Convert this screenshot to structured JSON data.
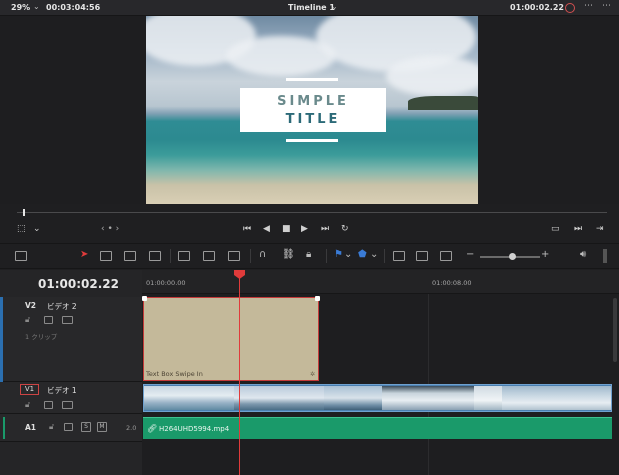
{
  "topbar": {
    "zoom": "29%",
    "duration": "00:03:04:56",
    "timeline_title": "Timeline 1",
    "timecode": "01:00:02.22",
    "chevron": "⌄"
  },
  "viewer": {
    "title_line1": "SIMPLE",
    "title_line2": "TITLE"
  },
  "transport": {
    "nav_dots": "‹ • ›"
  },
  "timeline": {
    "timecode": "01:00:02.22",
    "ruler": [
      "01:00:00.00",
      "01:00:08.00"
    ],
    "tracks": {
      "v2": {
        "id": "V2",
        "name": "ビデオ 2",
        "clip_count": "1 クリップ"
      },
      "v1": {
        "id": "V1",
        "name": "ビデオ 1"
      },
      "a1": {
        "id": "A1",
        "volume": "2.0",
        "s_label": "S",
        "m_label": "M"
      }
    },
    "clips": {
      "title_clip": "Text Box Swipe In",
      "audio_clip": "H264UHD5994.mp4"
    }
  },
  "colors": {
    "accent_red": "#e03b3b",
    "audio_green": "#1a9a6a",
    "video_blue": "#4a7fb0",
    "title_clip": "#c4b99a"
  }
}
